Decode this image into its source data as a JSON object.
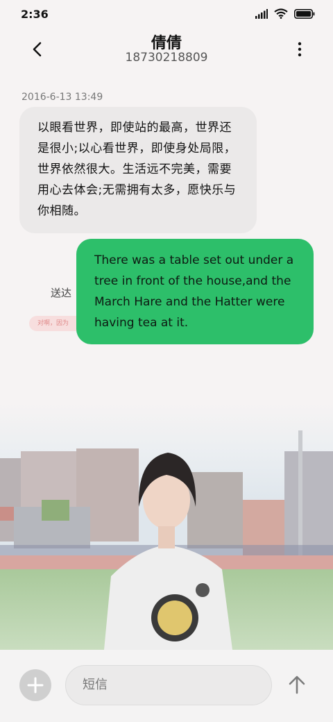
{
  "status": {
    "time": "2:36"
  },
  "header": {
    "contact_name": "倩倩",
    "phone": "18730218809"
  },
  "messages": {
    "timestamp": "2016-6-13 13:49",
    "incoming_text": "以眼看世界，即使站的最高，世界还是很小;以心看世界，即使身处局限，世界依然很大。生活远不完美，需要用心去体会;无需拥有太多，愿快乐与你相随。",
    "outgoing_text": "There was a table set out under a tree in front of the house,and the March Hare and the Hatter were having tea at it.",
    "sent_label": "送达",
    "hint_text": "对啊，因为"
  },
  "composer": {
    "placeholder": "短信"
  },
  "colors": {
    "outgoing_bubble": "#2dbf6a",
    "incoming_bubble": "#ebe9e9",
    "background": "#f6f3f3"
  },
  "icons": [
    "signal-icon",
    "wifi-icon",
    "battery-icon",
    "back-arrow-icon",
    "more-vertical-icon",
    "plus-icon",
    "send-arrow-icon"
  ]
}
